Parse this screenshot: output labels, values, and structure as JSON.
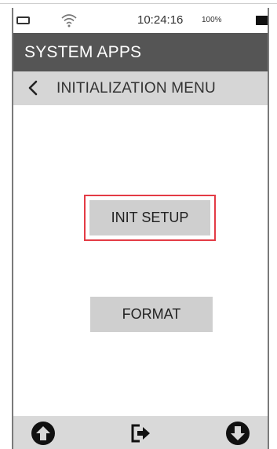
{
  "status_bar": {
    "time": "10:24:16",
    "battery_percent": "100%",
    "icons": [
      "battery-outline-icon",
      "wifi-icon",
      "battery-full-icon"
    ]
  },
  "app_bar": {
    "title": "SYSTEM APPS"
  },
  "sub_header": {
    "back_icon": "chevron-left-icon",
    "title": "INITIALIZATION MENU"
  },
  "menu": {
    "items": [
      {
        "label": "INIT SETUP",
        "selected": true
      },
      {
        "label": "FORMAT",
        "selected": false
      }
    ]
  },
  "bottom_nav": {
    "icons": [
      "arrow-up-circle-icon",
      "exit-icon",
      "arrow-down-circle-icon"
    ]
  },
  "colors": {
    "app_bar_bg": "#555555",
    "sub_bar_bg": "#d6d6d6",
    "button_bg": "#cfcfcf",
    "selection_border": "#e33b45",
    "bottom_bar_bg": "#d9d9d9"
  }
}
